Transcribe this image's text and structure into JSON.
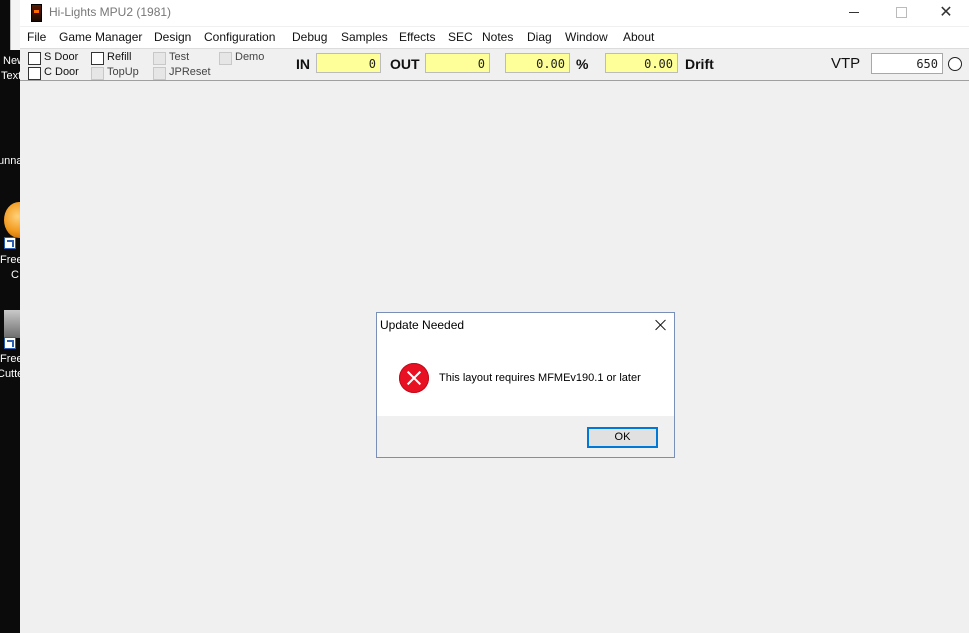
{
  "desktop": {
    "labels": [
      "New",
      "Text",
      "unna",
      "Free",
      "C",
      "Free",
      "Cutte"
    ]
  },
  "window": {
    "title": "Hi-Lights MPU2 (1981)",
    "controls": {
      "minimize": "—",
      "maximize": "☐",
      "close": "✕"
    }
  },
  "menu": {
    "items": [
      "File",
      "Game Manager",
      "Design",
      "Configuration",
      "Debug",
      "Samples",
      "Effects",
      "SEC",
      "Notes",
      "Diag",
      "Window",
      "About"
    ]
  },
  "toolbar": {
    "checkboxes": {
      "s_door": "S Door",
      "c_door": "C Door",
      "refill": "Refill",
      "topup": "TopUp",
      "test": "Test",
      "jpreset": "JPReset",
      "demo": "Demo"
    },
    "in_label": "IN",
    "in_value": "0",
    "out_label": "OUT",
    "out_value": "0",
    "percent_value": "0.00",
    "percent_label": "%",
    "drift_value": "0.00",
    "drift_label": "Drift",
    "vtp_label": "VTP",
    "vtp_value": "650"
  },
  "dialog": {
    "title": "Update Needed",
    "message": "This layout requires MFMEv190.1 or later",
    "ok_label": "OK",
    "icon": "error-icon"
  },
  "colors": {
    "field_yellow": "#ffff99",
    "error_red": "#e81123",
    "accent_blue": "#0078d7"
  }
}
